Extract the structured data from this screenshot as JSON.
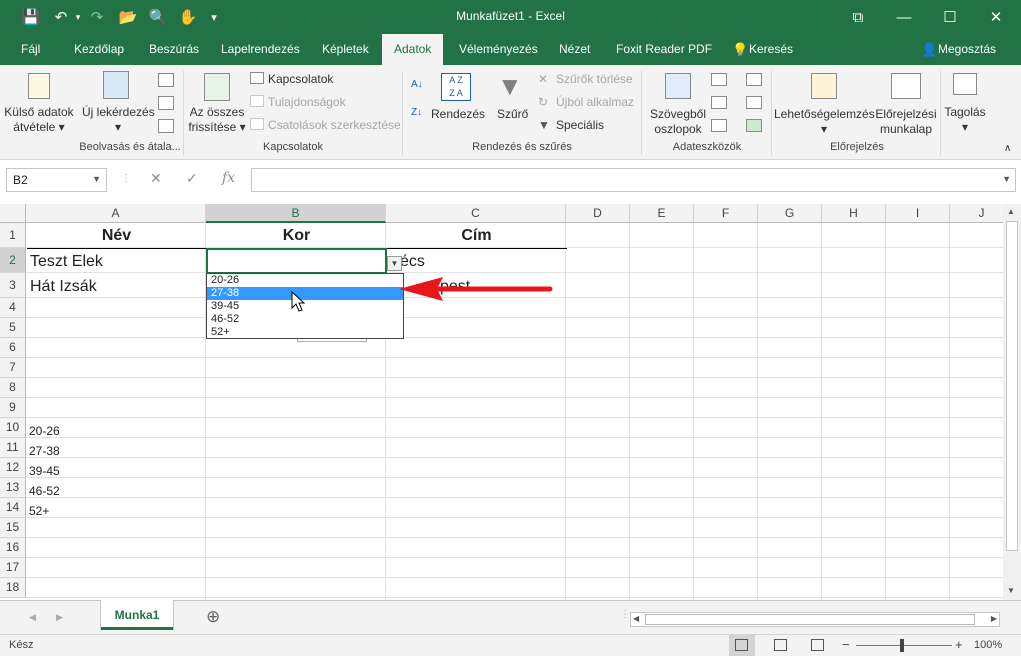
{
  "titlebar": {
    "title": "Munkafüzet1  -  Excel",
    "icons": {
      "save": "save-icon",
      "undo": "undo-icon",
      "redo": "redo-icon",
      "open": "open-folder-icon",
      "print_preview": "print-preview-icon",
      "touch_mode": "touch-mode-icon",
      "customize": "customize-qat-icon",
      "restore_ribbon": "ribbon-display-icon",
      "minimize": "minimize-icon",
      "maximize": "maximize-icon",
      "close": "close-icon"
    },
    "glyphs": {
      "save": "💾",
      "undo": "↶",
      "redo": "↷",
      "open": "📂",
      "print": "🔍",
      "touch": "✋",
      "customize": "▾",
      "ribbon": "⧉",
      "minimize": "—",
      "maximize": "☐",
      "close": "✕"
    }
  },
  "ribbon_tabs": [
    {
      "label": "Fájl"
    },
    {
      "label": "Kezdőlap"
    },
    {
      "label": "Beszúrás"
    },
    {
      "label": "Lapelrendezés"
    },
    {
      "label": "Képletek"
    },
    {
      "label": "Adatok",
      "active": true
    },
    {
      "label": "Véleményezés"
    },
    {
      "label": "Nézet"
    },
    {
      "label": "Foxit Reader PDF"
    },
    {
      "label": "Keresés"
    },
    {
      "label": "Megosztás"
    }
  ],
  "ribbon": {
    "kulso_adatok": {
      "line1": "Külső adatok",
      "line2": "átvétele"
    },
    "uj_lekerdezes": {
      "line1": "Új lekérdezés"
    },
    "osszes_frissitese": {
      "line1": "Az összes",
      "line2": "frissítése"
    },
    "kapcsolatok": "Kapcsolatok",
    "tulajdonsagok": "Tulajdonságok",
    "csatolasok": "Csatolások szerkesztése",
    "rendezes": "Rendezés",
    "szuro": "Szűrő",
    "szurok_torlese": "Szűrők törlése",
    "ujbol_alkalmaz": "Újból alkalmaz",
    "specialis": "Speciális",
    "szovegbol": {
      "line1": "Szövegből",
      "line2": "oszlopok"
    },
    "lehetosegelemzes": "Lehetőségelemzés",
    "elorejelzesi": {
      "line1": "Előrejelzési",
      "line2": "munkalap"
    },
    "tagolas": "Tagolás",
    "groups": {
      "beolvasas": "Beolvasás és átala...",
      "kapcsolatok": "Kapcsolatok",
      "rendezes_szures": "Rendezés és szűrés",
      "adateszkozok": "Adateszközök",
      "elorejelzes": "Előrejelzés"
    },
    "az_label": "A Z",
    "za_label": "Z A"
  },
  "formula_bar": {
    "name_box": "B2",
    "cancel": "✕",
    "enter": "✓",
    "fx": "fx",
    "value": ""
  },
  "columns": [
    "A",
    "B",
    "C",
    "D",
    "E",
    "F",
    "G",
    "H",
    "I",
    "J"
  ],
  "rows": [
    "1",
    "2",
    "3",
    "4",
    "5",
    "6",
    "7",
    "8",
    "9",
    "10",
    "11",
    "12",
    "13",
    "14",
    "15",
    "16",
    "17",
    "18"
  ],
  "cells": {
    "A1": "Név",
    "B1": "Kor",
    "C1": "Cím",
    "A2": "Teszt Elek",
    "C2": "écs",
    "A3": "Hát Izsák",
    "C3": "pest",
    "A10": "20-26",
    "A11": "27-38",
    "A12": "39-45",
    "A13": "46-52",
    "A14": "52+"
  },
  "dropdown": {
    "options": [
      "20-26",
      "27-38",
      "39-45",
      "46-52",
      "52+"
    ],
    "highlighted_index": 1,
    "arrow_color": "#e8161b"
  },
  "sheet_tabs": {
    "active": "Munka1",
    "add": "⊕"
  },
  "status": {
    "ready": "Kész",
    "zoom": "100%",
    "zoom_minus": "−",
    "zoom_plus": "+"
  },
  "colors": {
    "accent": "#217346",
    "selection": "#217346",
    "highlight": "#3399ff"
  }
}
